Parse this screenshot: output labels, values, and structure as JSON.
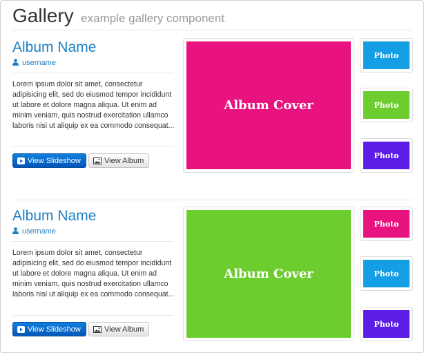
{
  "header": {
    "title": "Gallery",
    "subtitle": "example gallery component"
  },
  "colors": {
    "pink": "#e8137f",
    "green": "#6dcd2e",
    "blue": "#149ee3",
    "purple": "#5b1ce6",
    "link": "#1e7fc4"
  },
  "albums": [
    {
      "name": "Album Name",
      "username": "username",
      "description": "Lorem ipsum dolor sit amet, consectetur adipisicing elit, sed do eiusmod tempor incididunt ut labore et dolore magna aliqua. Ut enim ad minim veniam, quis nostrud exercitation ullamco laboris nisi ut aliquip ex ea commodo consequat...",
      "slideshow_label": "View Slideshow",
      "album_label": "View Album",
      "cover_label": "Album Cover",
      "cover_color": "#e8137f",
      "photos": [
        {
          "label": "Photo",
          "color": "#149ee3"
        },
        {
          "label": "Photo",
          "color": "#6dcd2e"
        },
        {
          "label": "Photo",
          "color": "#5b1ce6"
        }
      ]
    },
    {
      "name": "Album Name",
      "username": "username",
      "description": "Lorem ipsum dolor sit amet, consectetur adipisicing elit, sed do eiusmod tempor incididunt ut labore et dolore magna aliqua. Ut enim ad minim veniam, quis nostrud exercitation ullamco laboris nisi ut aliquip ex ea commodo consequat...",
      "slideshow_label": "View Slideshow",
      "album_label": "View Album",
      "cover_label": "Album Cover",
      "cover_color": "#6dcd2e",
      "photos": [
        {
          "label": "Photo",
          "color": "#e8137f"
        },
        {
          "label": "Photo",
          "color": "#149ee3"
        },
        {
          "label": "Photo",
          "color": "#5b1ce6"
        }
      ]
    }
  ]
}
